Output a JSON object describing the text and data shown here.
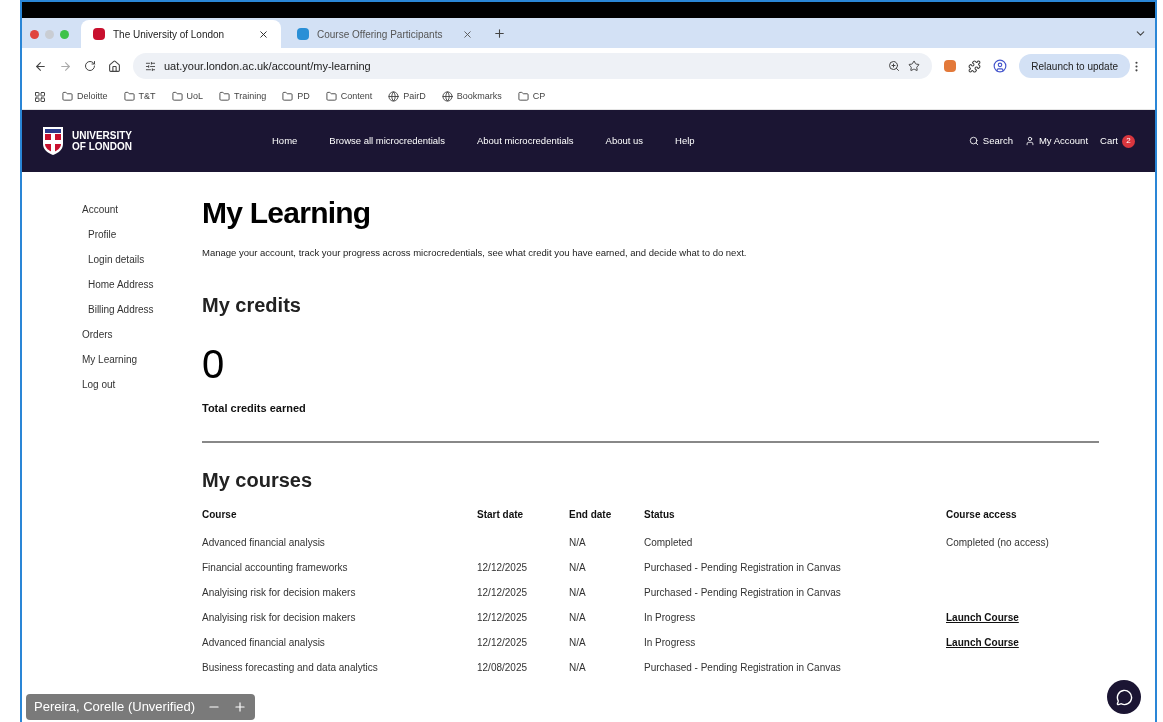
{
  "browser": {
    "tabs": [
      {
        "title": "The University of London",
        "selected": true
      },
      {
        "title": "Course Offering Participants",
        "selected": false
      }
    ],
    "url": "uat.your.london.ac.uk/account/my-learning",
    "relaunch": "Relaunch to update",
    "bookmarks": [
      {
        "label": "Deloitte",
        "kind": "folder"
      },
      {
        "label": "T&T",
        "kind": "folder"
      },
      {
        "label": "UoL",
        "kind": "folder"
      },
      {
        "label": "Training",
        "kind": "folder"
      },
      {
        "label": "PD",
        "kind": "folder"
      },
      {
        "label": "Content",
        "kind": "folder"
      },
      {
        "label": "PairD",
        "kind": "globe"
      },
      {
        "label": "Bookmarks",
        "kind": "globe"
      },
      {
        "label": "CP",
        "kind": "folder"
      }
    ]
  },
  "site": {
    "logo": [
      "UNIVERSITY",
      "OF LONDON"
    ],
    "nav": [
      "Home",
      "Browse all microcredentials",
      "About microcredentials",
      "About us",
      "Help"
    ],
    "search": "Search",
    "account": "My Account",
    "cart": "Cart",
    "cart_count": "2"
  },
  "sidebar": {
    "items": [
      {
        "label": "Account",
        "children": [
          {
            "label": "Profile"
          },
          {
            "label": "Login details"
          },
          {
            "label": "Home Address"
          },
          {
            "label": "Billing Address"
          }
        ]
      },
      {
        "label": "Orders"
      },
      {
        "label": "My Learning"
      },
      {
        "label": "Log out"
      }
    ]
  },
  "main": {
    "title": "My Learning",
    "intro": "Manage your account, track your progress across microcredentials, see what credit you have earned, and decide what to do next.",
    "credits_heading": "My credits",
    "credits_value": "0",
    "credits_label": "Total credits earned",
    "courses_heading": "My courses"
  },
  "table": {
    "columns": [
      "Course",
      "Start date",
      "End date",
      "Status",
      "Course access"
    ],
    "rows": [
      {
        "course": "Advanced financial analysis",
        "end": "N/A",
        "status": "Completed",
        "access": "Completed (no access)",
        "kind": "text"
      },
      {
        "course": "Financial accounting frameworks",
        "start": "12/12/2025",
        "end": "N/A",
        "status": "Purchased - Pending Registration in Canvas"
      },
      {
        "course": "Analyising risk for decision makers",
        "start": "12/12/2025",
        "end": "N/A",
        "status": "Purchased - Pending Registration in Canvas"
      },
      {
        "course": "Analyising risk for decision makers",
        "start": "12/12/2025",
        "end": "N/A",
        "status": "In Progress",
        "access": "Launch Course",
        "kind": "link"
      },
      {
        "course": "Advanced financial analysis",
        "start": "12/12/2025",
        "end": "N/A",
        "status": "In Progress",
        "access": "Launch Course",
        "kind": "link"
      },
      {
        "course": "Business forecasting and data analytics",
        "start": "12/08/2025",
        "end": "N/A",
        "status": "Purchased - Pending Registration in Canvas"
      }
    ]
  },
  "call_overlay": {
    "name": "Pereira, Corelle (Unverified)"
  }
}
